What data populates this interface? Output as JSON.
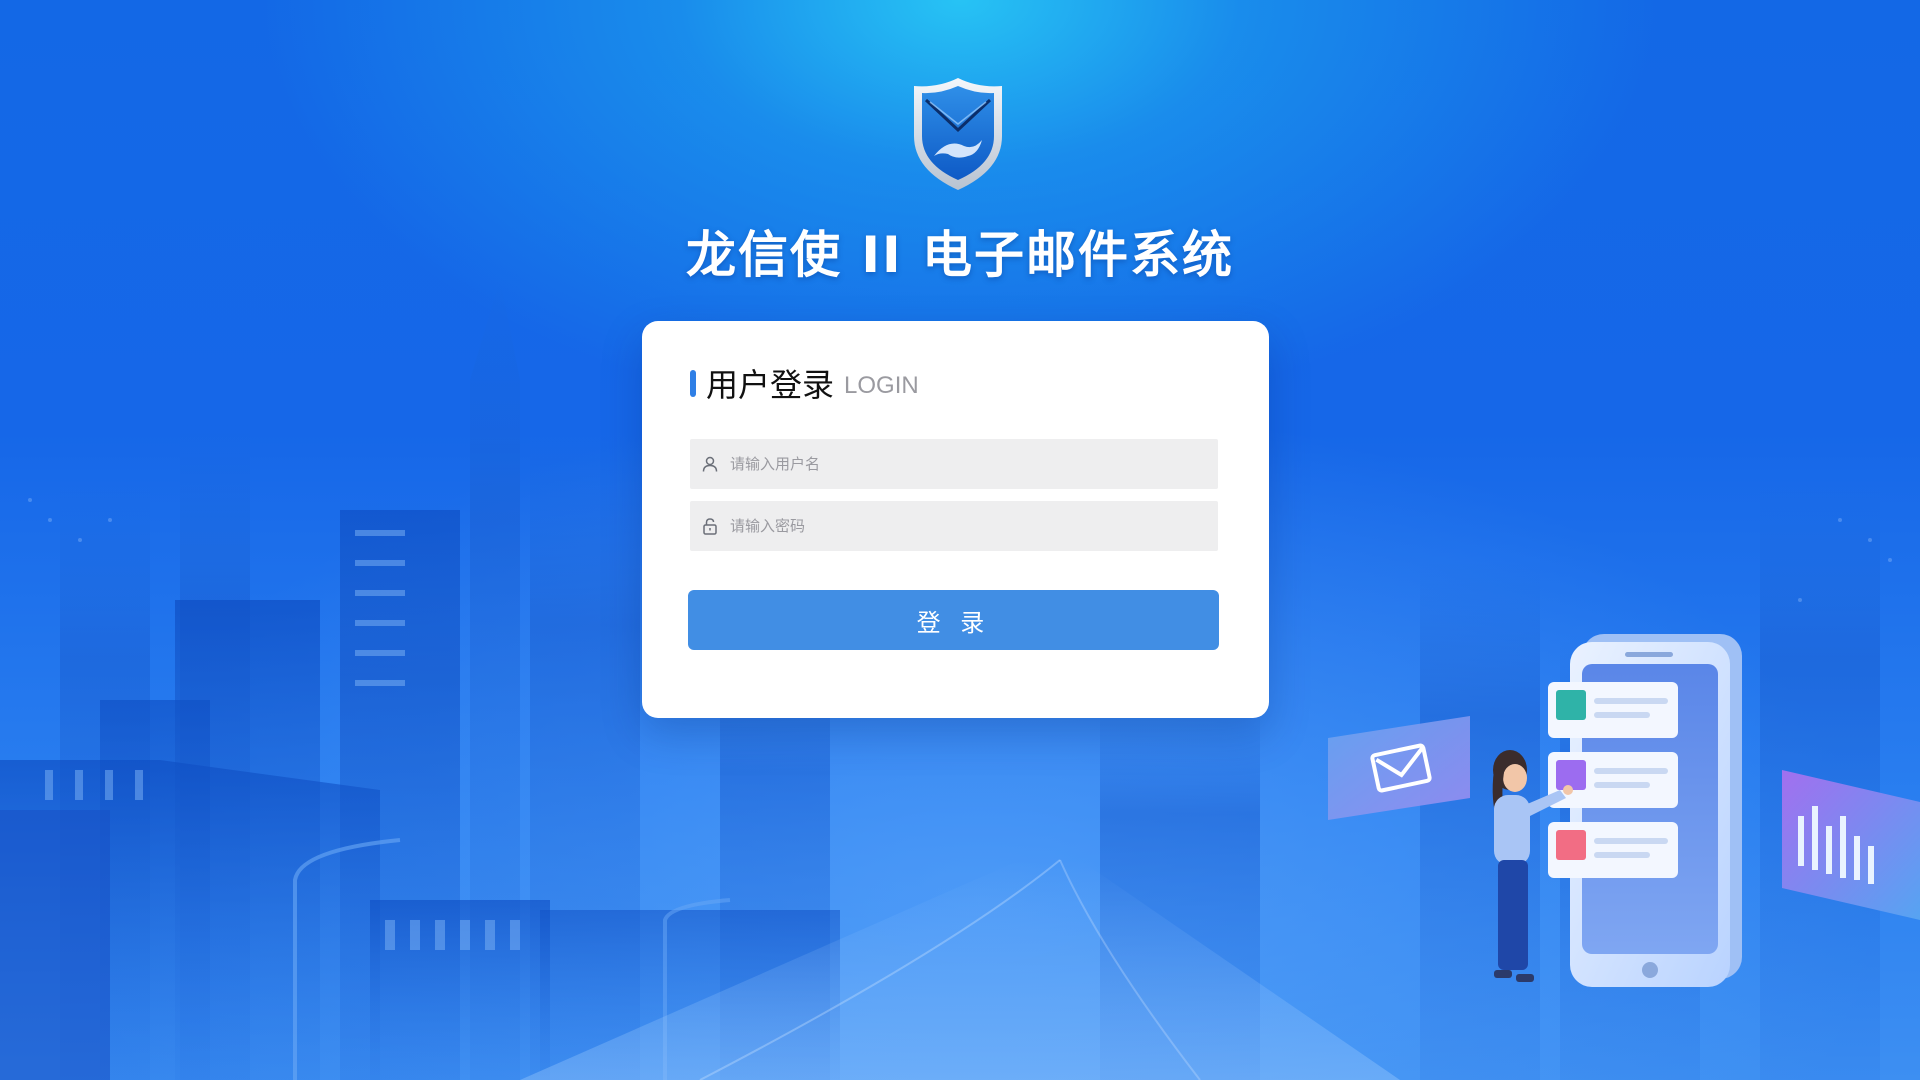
{
  "app": {
    "system_title": "龙信使 II 电子邮件系统"
  },
  "login_card": {
    "title": "用户登录",
    "subtitle": "LOGIN",
    "username_placeholder": "请输入用户名",
    "password_placeholder": "请输入密码",
    "submit_label": "登 录"
  },
  "icons": {
    "logo": "shield-envelope-dragon-icon",
    "username": "user-icon",
    "password": "lock-icon",
    "illustration_mail": "mail-icon",
    "illustration_chart": "bar-chart-icon"
  },
  "colors": {
    "background_top": "#1aa8f0",
    "background_main": "#1667e8",
    "card_bg": "#ffffff",
    "accent": "#2f7fe6",
    "button": "#418ee4",
    "input_bg": "#eeeeef",
    "placeholder": "#9a9aa0"
  }
}
